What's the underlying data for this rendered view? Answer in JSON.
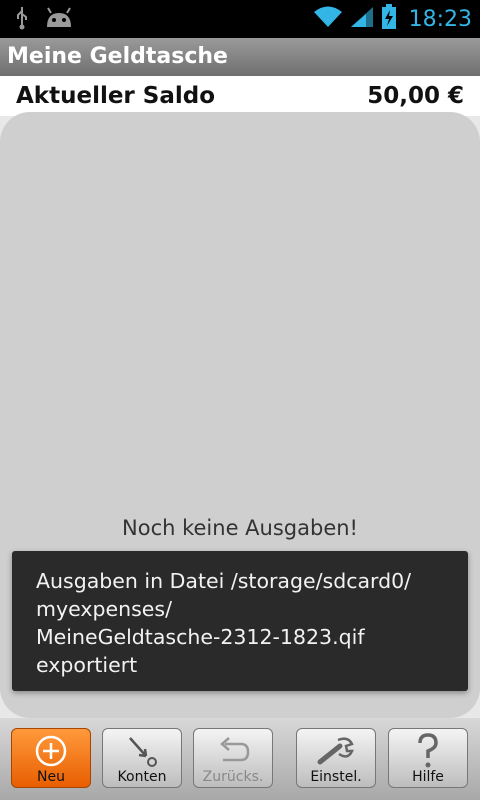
{
  "status_bar": {
    "time": "18:23",
    "icons": [
      "usb-icon",
      "android-icon",
      "wifi-icon",
      "signal-icon",
      "battery-icon"
    ]
  },
  "app": {
    "title": "Meine Geldtasche"
  },
  "balance": {
    "label": "Aktueller Saldo",
    "value": "50,00 €"
  },
  "main": {
    "empty_message": "Noch keine Ausgaben!"
  },
  "toast": {
    "message": "Ausgaben in Datei /storage/sdcard0/\nmyexpenses/\nMeineGeldtasche-2312-1823.qif\nexportiert"
  },
  "toolbar": {
    "buttons": [
      {
        "label": "Neu",
        "icon": "plus-circle-icon",
        "state": "active"
      },
      {
        "label": "Konten",
        "icon": "accounts-arrow-icon",
        "state": "normal"
      },
      {
        "label": "Zurücks.",
        "icon": "undo-icon",
        "state": "disabled"
      },
      {
        "label": "Einstel.",
        "icon": "wrench-icon",
        "state": "normal"
      },
      {
        "label": "Hilfe",
        "icon": "question-icon",
        "state": "normal"
      }
    ]
  },
  "colors": {
    "status_accent": "#33b5e5",
    "active_button": "#f07a10",
    "toast_bg": "#2a2a2a",
    "panel_bg": "#cfcfcf"
  }
}
